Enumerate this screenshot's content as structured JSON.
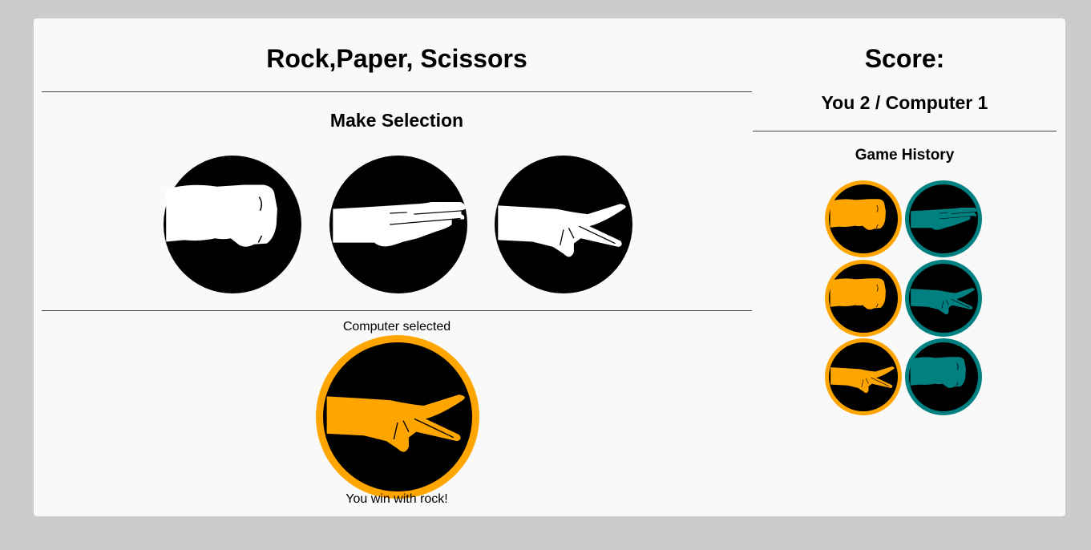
{
  "game": {
    "title": "Rock,Paper, Scissors",
    "selection_heading": "Make Selection",
    "choices": [
      {
        "name": "rock",
        "icon": "rock-fist-icon"
      },
      {
        "name": "paper",
        "icon": "paper-flat-hand-icon"
      },
      {
        "name": "scissors",
        "icon": "scissors-two-finger-icon"
      }
    ],
    "computer_label": "Computer selected",
    "computer_choice": "scissors",
    "result_text": "You win with rock!"
  },
  "score": {
    "title": "Score:",
    "line": "You 2 / Computer 1"
  },
  "history": {
    "title": "Game History",
    "rounds": [
      {
        "you": "rock",
        "computer": "paper"
      },
      {
        "you": "rock",
        "computer": "scissors"
      },
      {
        "you": "scissors",
        "computer": "rock"
      }
    ]
  },
  "colors": {
    "you": "#ffa500",
    "computer": "#008080",
    "choice_hand": "#ffffff",
    "circle": "#000000"
  }
}
